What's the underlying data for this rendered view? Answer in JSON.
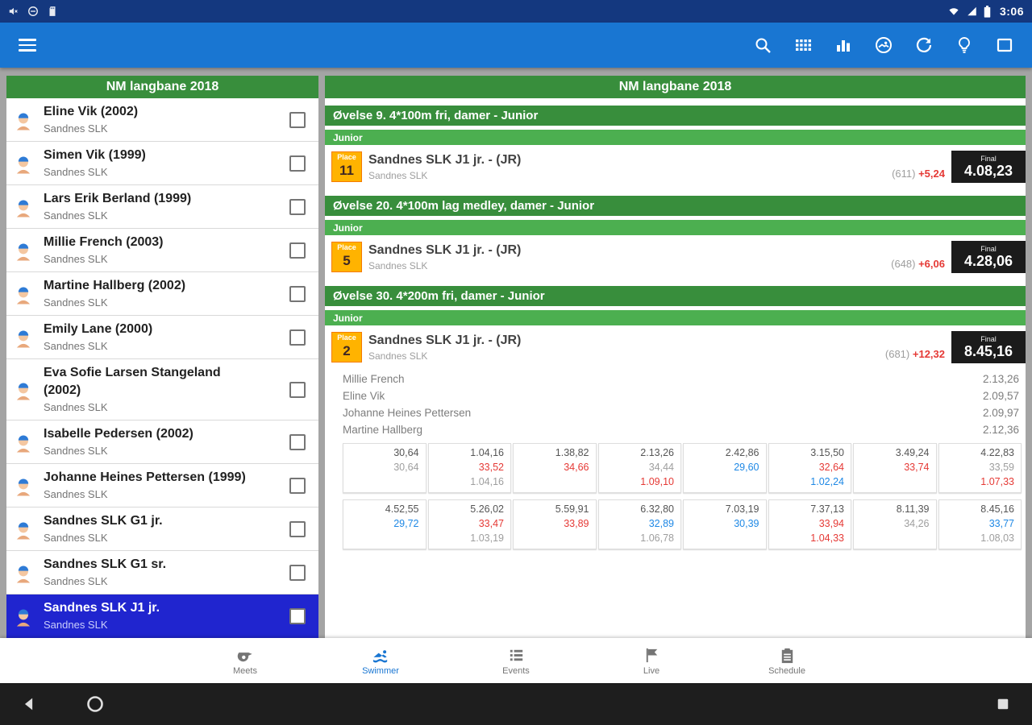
{
  "status_bar": {
    "time": "3:06"
  },
  "left_panel": {
    "title": "NM langbane 2018",
    "swimmers": [
      {
        "name": "Eline Vik (2002)",
        "club": "Sandnes SLK",
        "selected": false
      },
      {
        "name": "Simen Vik (1999)",
        "club": "Sandnes SLK",
        "selected": false
      },
      {
        "name": "Lars Erik Berland (1999)",
        "club": "Sandnes SLK",
        "selected": false
      },
      {
        "name": "Millie French (2003)",
        "club": "Sandnes SLK",
        "selected": false
      },
      {
        "name": "Martine Hallberg (2002)",
        "club": "Sandnes SLK",
        "selected": false
      },
      {
        "name": "Emily Lane (2000)",
        "club": "Sandnes SLK",
        "selected": false
      },
      {
        "name": "Eva Sofie Larsen Stangeland (2002)",
        "club": "Sandnes SLK",
        "selected": false
      },
      {
        "name": "Isabelle Pedersen (2002)",
        "club": "Sandnes SLK",
        "selected": false
      },
      {
        "name": "Johanne Heines Pettersen (1999)",
        "club": "Sandnes SLK",
        "selected": false
      },
      {
        "name": "Sandnes SLK G1 jr.",
        "club": "Sandnes SLK",
        "selected": false
      },
      {
        "name": "Sandnes SLK G1 sr.",
        "club": "Sandnes SLK",
        "selected": false
      },
      {
        "name": "Sandnes SLK J1 jr.",
        "club": "Sandnes SLK",
        "selected": true
      }
    ]
  },
  "right_panel": {
    "title": "NM langbane 2018",
    "events": [
      {
        "header": "Øvelse 9. 4*100m fri, damer - Junior",
        "group": "Junior",
        "result": {
          "place_label": "Place",
          "place": "11",
          "team": "Sandnes SLK J1 jr. - (JR)",
          "club": "Sandnes SLK",
          "points": "(611)",
          "delta": "+5,24",
          "final_label": "Final",
          "time": "4.08,23"
        }
      },
      {
        "header": "Øvelse 20. 4*100m lag medley, damer - Junior",
        "group": "Junior",
        "result": {
          "place_label": "Place",
          "place": "5",
          "team": "Sandnes SLK J1 jr. - (JR)",
          "club": "Sandnes SLK",
          "points": "(648)",
          "delta": "+6,06",
          "final_label": "Final",
          "time": "4.28,06"
        }
      },
      {
        "header": "Øvelse 30. 4*200m fri, damer - Junior",
        "group": "Junior",
        "result": {
          "place_label": "Place",
          "place": "2",
          "team": "Sandnes SLK J1 jr. - (JR)",
          "club": "Sandnes SLK",
          "points": "(681)",
          "delta": "+12,32",
          "final_label": "Final",
          "time": "8.45,16"
        },
        "legs": [
          {
            "name": "Millie French",
            "time": "2.13,26"
          },
          {
            "name": "Eline Vik",
            "time": "2.09,57"
          },
          {
            "name": "Johanne Heines Pettersen",
            "time": "2.09,97"
          },
          {
            "name": "Martine Hallberg",
            "time": "2.12,36"
          }
        ],
        "splits": [
          [
            [
              [
                "30,64",
                "dark"
              ],
              [
                "30,64",
                "gray"
              ]
            ],
            [
              [
                "1.04,16",
                "dark"
              ],
              [
                "33,52",
                "red"
              ],
              [
                "1.04,16",
                "gray"
              ]
            ],
            [
              [
                "1.38,82",
                "dark"
              ],
              [
                "34,66",
                "red"
              ]
            ],
            [
              [
                "2.13,26",
                "dark"
              ],
              [
                "34,44",
                "gray"
              ],
              [
                "1.09,10",
                "red"
              ]
            ],
            [
              [
                "2.42,86",
                "dark"
              ],
              [
                "29,60",
                "blue"
              ]
            ],
            [
              [
                "3.15,50",
                "dark"
              ],
              [
                "32,64",
                "red"
              ],
              [
                "1.02,24",
                "blue"
              ]
            ],
            [
              [
                "3.49,24",
                "dark"
              ],
              [
                "33,74",
                "red"
              ]
            ],
            [
              [
                "4.22,83",
                "dark"
              ],
              [
                "33,59",
                "gray"
              ],
              [
                "1.07,33",
                "red"
              ]
            ]
          ],
          [
            [
              [
                "4.52,55",
                "dark"
              ],
              [
                "29,72",
                "blue"
              ]
            ],
            [
              [
                "5.26,02",
                "dark"
              ],
              [
                "33,47",
                "red"
              ],
              [
                "1.03,19",
                "gray"
              ]
            ],
            [
              [
                "5.59,91",
                "dark"
              ],
              [
                "33,89",
                "red"
              ]
            ],
            [
              [
                "6.32,80",
                "dark"
              ],
              [
                "32,89",
                "blue"
              ],
              [
                "1.06,78",
                "gray"
              ]
            ],
            [
              [
                "7.03,19",
                "dark"
              ],
              [
                "30,39",
                "blue"
              ]
            ],
            [
              [
                "7.37,13",
                "dark"
              ],
              [
                "33,94",
                "red"
              ],
              [
                "1.04,33",
                "red"
              ]
            ],
            [
              [
                "8.11,39",
                "dark"
              ],
              [
                "34,26",
                "gray"
              ]
            ],
            [
              [
                "8.45,16",
                "dark"
              ],
              [
                "33,77",
                "blue"
              ],
              [
                "1.08,03",
                "gray"
              ]
            ]
          ]
        ]
      }
    ]
  },
  "bottom_nav": {
    "items": [
      {
        "label": "Meets",
        "icon": "whistle",
        "active": false
      },
      {
        "label": "Swimmer",
        "icon": "swimmer",
        "active": true
      },
      {
        "label": "Events",
        "icon": "list",
        "active": false
      },
      {
        "label": "Live",
        "icon": "flag",
        "active": false
      },
      {
        "label": "Schedule",
        "icon": "clipboard",
        "active": false
      }
    ]
  },
  "colors": {
    "toolbar": "#1976d2",
    "status_bar": "#14387f",
    "header_green": "#388e3c",
    "group_green": "#4caf50",
    "selected_blue": "#2025cf",
    "place_orange": "#ffb300",
    "final_black": "#1b1b1b",
    "delta_red": "#e53935",
    "split_blue": "#1e88e5"
  }
}
